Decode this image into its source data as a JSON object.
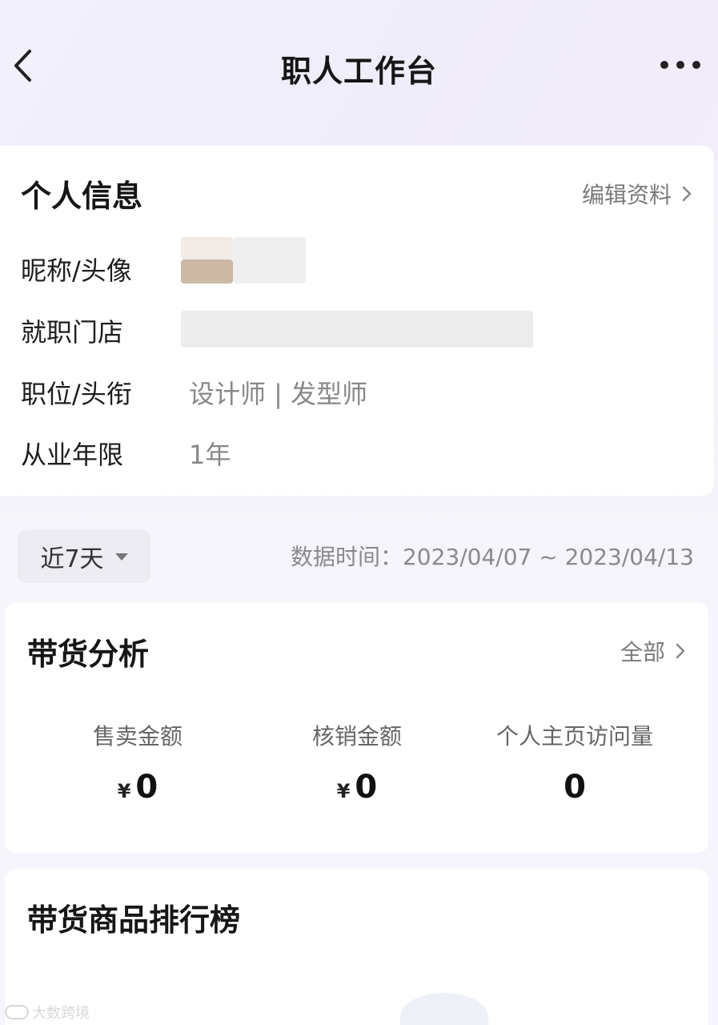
{
  "header": {
    "title": "职人工作台"
  },
  "personal_info": {
    "title": "个人信息",
    "edit_link": "编辑资料",
    "rows": [
      {
        "label": "昵称/头像",
        "value": ""
      },
      {
        "label": "就职门店",
        "value": ""
      },
      {
        "label": "职位/头衔",
        "value": "设计师 | 发型师"
      },
      {
        "label": "从业年限",
        "value": "1年"
      }
    ]
  },
  "filter": {
    "range_label": "近7天",
    "data_time": "数据时间：2023/04/07 ~ 2023/04/13"
  },
  "analysis": {
    "title": "带货分析",
    "all_link": "全部",
    "stats": [
      {
        "label": "售卖金额",
        "currency": "¥",
        "value": "0"
      },
      {
        "label": "核销金额",
        "currency": "¥",
        "value": "0"
      },
      {
        "label": "个人主页访问量",
        "currency": "",
        "value": "0"
      }
    ]
  },
  "ranking": {
    "title": "带货商品排行榜"
  },
  "watermark": {
    "text": "大数跨境"
  },
  "colors": {
    "background": "#f4f4fa",
    "card": "#ffffff",
    "muted_text": "#888888"
  }
}
